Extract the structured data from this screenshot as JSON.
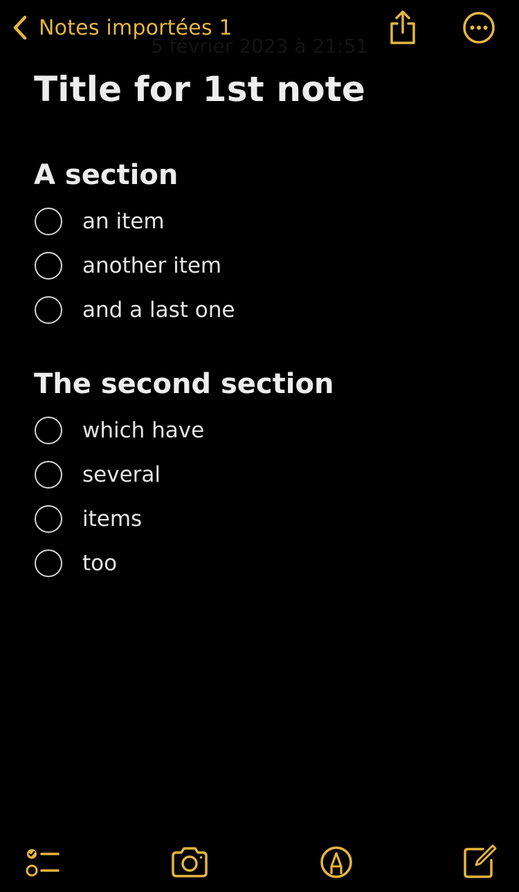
{
  "nav": {
    "back_label": "Notes importées 1",
    "date": "5 février 2023 à 21:51",
    "back_icon": "chevron-left-icon",
    "share_icon": "share-icon",
    "more_icon": "ellipsis-circle-icon"
  },
  "note": {
    "title": "Title for 1st note",
    "sections": [
      {
        "heading": "A section",
        "items": [
          "an item",
          "another item",
          "and a last one"
        ]
      },
      {
        "heading": "The second section",
        "items": [
          "which have",
          "several",
          "items",
          "too"
        ]
      }
    ]
  },
  "toolbar": {
    "checklist_icon": "checklist-icon",
    "camera_icon": "camera-icon",
    "markup_icon": "markup-pen-icon",
    "compose_icon": "compose-icon"
  },
  "colors": {
    "accent": "#e5b53f",
    "background": "#000000",
    "text": "#e8e8e8"
  }
}
